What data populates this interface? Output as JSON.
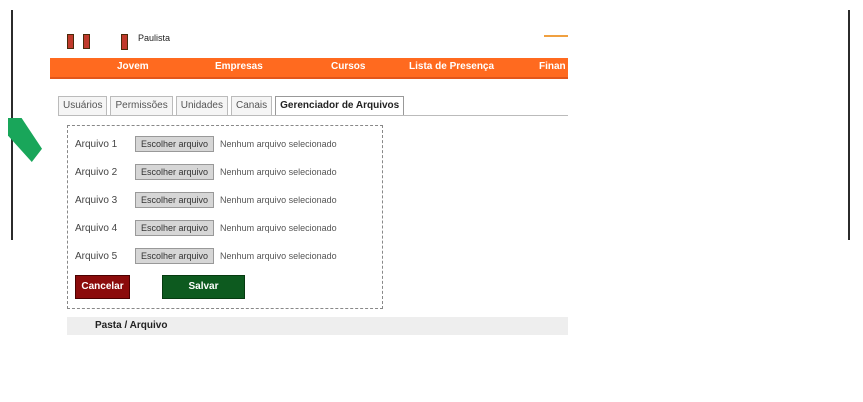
{
  "header": {
    "site_name": "Paulista"
  },
  "nav": {
    "items": [
      "Jovem",
      "Empresas",
      "Cursos",
      "Lista de Presença",
      "Finan"
    ]
  },
  "tabs": [
    "Usuários",
    "Permissões",
    "Unidades",
    "Canais",
    "Gerenciador de Arquivos"
  ],
  "active_tab": "Gerenciador de Arquivos",
  "upload": {
    "files": [
      {
        "label": "Arquivo 1",
        "button": "Escolher arquivo",
        "status": "Nenhum arquivo selecionado"
      },
      {
        "label": "Arquivo 2",
        "button": "Escolher arquivo",
        "status": "Nenhum arquivo selecionado"
      },
      {
        "label": "Arquivo 3",
        "button": "Escolher arquivo",
        "status": "Nenhum arquivo selecionado"
      },
      {
        "label": "Arquivo 4",
        "button": "Escolher arquivo",
        "status": "Nenhum arquivo selecionado"
      },
      {
        "label": "Arquivo 5",
        "button": "Escolher arquivo",
        "status": "Nenhum arquivo selecionado"
      }
    ],
    "cancel_label": "Cancelar",
    "save_label": "Salvar"
  },
  "table": {
    "header": "Pasta / Arquivo"
  },
  "colors": {
    "nav": "#ff6a1f",
    "cancel": "#8b0b0b",
    "save": "#0d5a1f",
    "arrow": "#19a65a"
  }
}
